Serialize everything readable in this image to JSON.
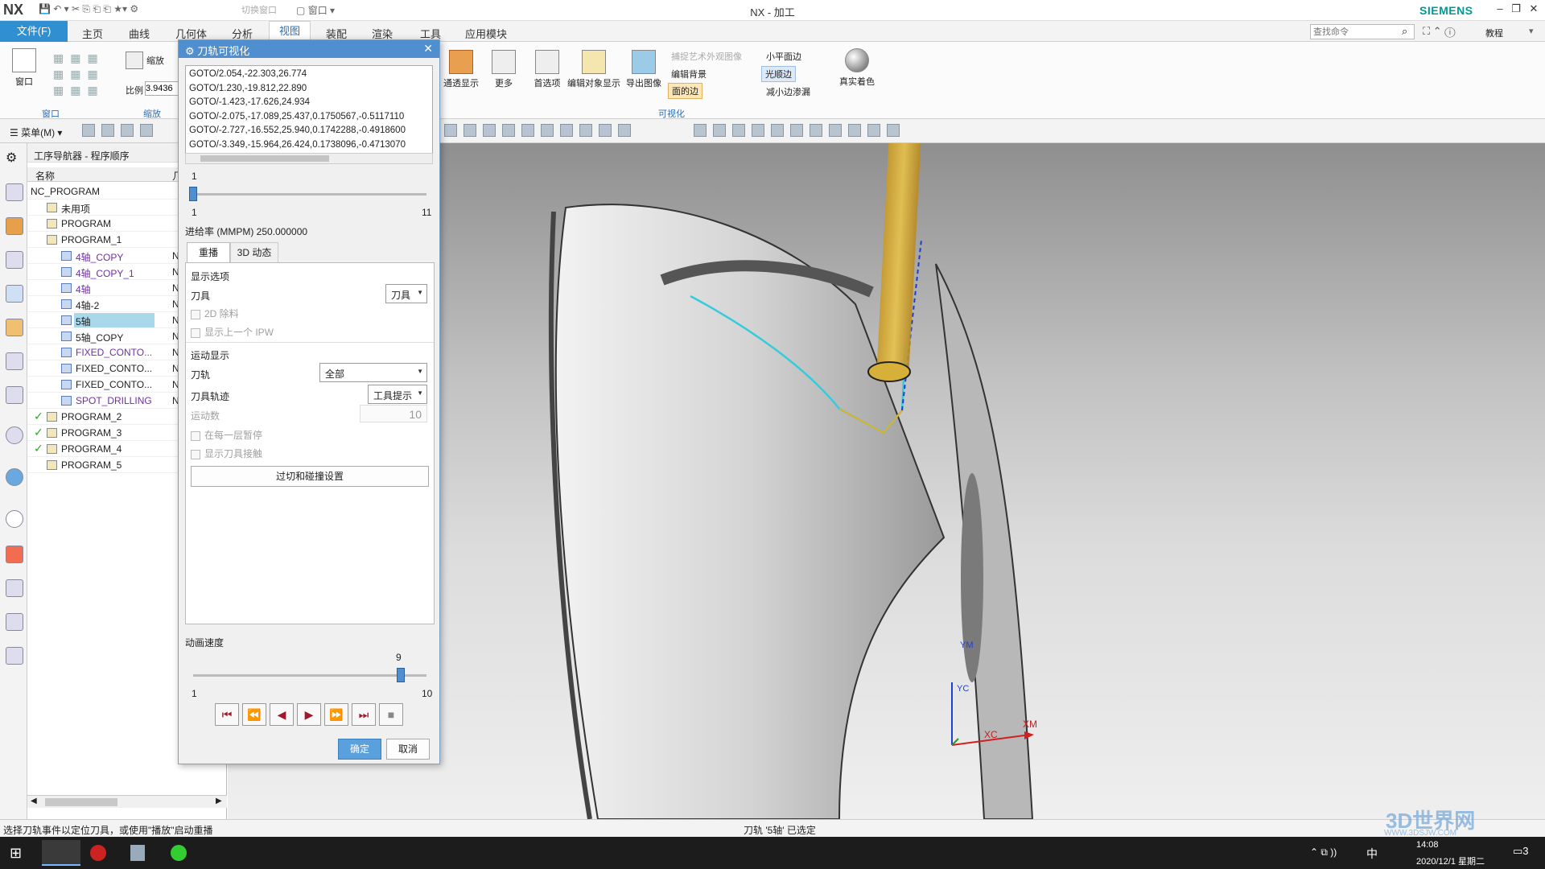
{
  "app": {
    "logo": "NX",
    "title": "NX - 加工",
    "brand": "SIEMENS",
    "switch_window": "切换窗口",
    "window_label": "窗口"
  },
  "menus": {
    "file": "文件(F)",
    "items": [
      "主页",
      "曲线",
      "几何体",
      "分析",
      "视图",
      "装配",
      "渲染",
      "工具",
      "应用模块"
    ],
    "active": "视图"
  },
  "search": {
    "placeholder": "查找命令"
  },
  "help_label": "教程",
  "ribbon": {
    "window_group": "窗口",
    "window_btn": "窗口",
    "zoom_group": "缩放",
    "zoom_btn": "缩放",
    "scale_label": "比例",
    "scale_value": "3.9436",
    "visual_group": "可视化",
    "transparent": "通透显示",
    "more": "更多",
    "preferences": "首选项",
    "edit_display": "编辑对象显示",
    "export_image": "导出图像",
    "capture_art": "捕捉艺术外观图像",
    "edit_bg": "编辑背景",
    "face_edges": "面的边",
    "small_plane": "小平面边",
    "smooth_edges": "光顺边",
    "reduce_edges": "减小边渗漏",
    "true_shading": "真实着色"
  },
  "toolbar2": {
    "menu": "菜单(M)"
  },
  "navigator": {
    "title": "工序导航器 - 程序顺序",
    "col_name": "名称",
    "col2": "几",
    "rows": [
      {
        "name": "NC_PROGRAM",
        "col2": "",
        "kind": "root"
      },
      {
        "name": "未用项",
        "col2": "",
        "kind": "group"
      },
      {
        "name": "PROGRAM",
        "col2": "",
        "kind": "group"
      },
      {
        "name": "PROGRAM_1",
        "col2": "",
        "kind": "group"
      },
      {
        "name": "4轴_COPY",
        "col2": "N",
        "kind": "op-purple"
      },
      {
        "name": "4轴_COPY_1",
        "col2": "N",
        "kind": "op-purple"
      },
      {
        "name": "4轴",
        "col2": "N",
        "kind": "op-purple"
      },
      {
        "name": "4轴-2",
        "col2": "N",
        "kind": "op"
      },
      {
        "name": "5轴",
        "col2": "N",
        "kind": "op-selected"
      },
      {
        "name": "5轴_COPY",
        "col2": "N",
        "kind": "op"
      },
      {
        "name": "FIXED_CONTO...",
        "col2": "N",
        "kind": "op-purple"
      },
      {
        "name": "FIXED_CONTO...",
        "col2": "N",
        "kind": "op"
      },
      {
        "name": "FIXED_CONTO...",
        "col2": "N",
        "kind": "op"
      },
      {
        "name": "SPOT_DRILLING",
        "col2": "N",
        "kind": "op-purple"
      },
      {
        "name": "PROGRAM_2",
        "col2": "",
        "kind": "group-check"
      },
      {
        "name": "PROGRAM_3",
        "col2": "",
        "kind": "group-check"
      },
      {
        "name": "PROGRAM_4",
        "col2": "",
        "kind": "group-check"
      },
      {
        "name": "PROGRAM_5",
        "col2": "",
        "kind": "group"
      }
    ]
  },
  "dialog": {
    "title": "刀轨可视化",
    "goto_lines": [
      "GOTO/2.054,-22.303,26.774",
      "GOTO/1.230,-19.812,22.890",
      "GOTO/-1.423,-17.626,24.934",
      "GOTO/-2.075,-17.089,25.437,0.1750567,-0.5117110",
      "GOTO/-2.727,-16.552,25.940,0.1742288,-0.4918600",
      "GOTO/-3.349,-15.964,26.424,0.1738096,-0.4713070"
    ],
    "pos_value": "1",
    "pos_min": "1",
    "pos_max": "11",
    "pos_fraction": 0.0,
    "feed_rate": "进给率 (MMPM) 250.000000",
    "tab_replay": "重播",
    "tab_3d": "3D 动态",
    "display_options": "显示选项",
    "tool_label": "刀具",
    "tool_value": "刀具",
    "remove_2d": "2D 除料",
    "show_prev_ipw": "显示上一个 IPW",
    "motion_display": "运动显示",
    "path_label": "刀轨",
    "path_value": "全部",
    "trace_label": "刀具轨迹",
    "trace_value": "工具提示",
    "motion_count_label": "运动数",
    "motion_count": "10",
    "pause_each_layer": "在每一层暂停",
    "show_contact": "显示刀具接触",
    "gouge_btn": "过切和碰撞设置",
    "anim_speed": "动画速度",
    "speed_value": "9",
    "speed_min": "1",
    "speed_max": "10",
    "speed_fraction": 0.889,
    "play_buttons": [
      "⏮",
      "⏪",
      "◀",
      "▶",
      "⏩",
      "⏭",
      "■"
    ],
    "ok": "确定",
    "cancel": "取消"
  },
  "viewport": {
    "axis_x": "XC",
    "axis_xm": "XM",
    "axis_y": "YC",
    "axis_ym": "YM"
  },
  "status": {
    "left": "选择刀轨事件以定位刀具，或使用\"播放\"启动重播",
    "center": "刀轨 '5轴' 已选定"
  },
  "taskbar": {
    "ime": "中",
    "time": "14:08",
    "date": "2020/12/1 星期二",
    "watermark": "3D世界网",
    "watermark_url": "WWW.3DSJW.COM",
    "notif": "3"
  },
  "colors": {
    "accent": "#2f8fd0",
    "dialog_title": "#4f8fcf",
    "tool": "#d9b13a",
    "toolpath": "#33ccdd",
    "purple_text": "#7030a0"
  }
}
